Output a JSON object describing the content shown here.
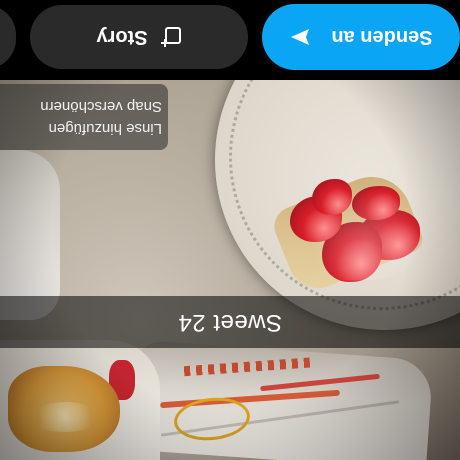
{
  "photo": {
    "description_icon": "food-photo"
  },
  "caption": {
    "text": "Sweet 24"
  },
  "edit_menu": {
    "items": [
      {
        "label": "Linse hinzufügen"
      },
      {
        "label": "Snap verschönern"
      }
    ]
  },
  "actions": {
    "send_label": "Senden an",
    "send_icon": "send-arrow-icon",
    "story_label": "Story",
    "story_icon": "add-story-icon",
    "accent_color": "#0aa5f5",
    "secondary_color": "#2a2a2a"
  }
}
